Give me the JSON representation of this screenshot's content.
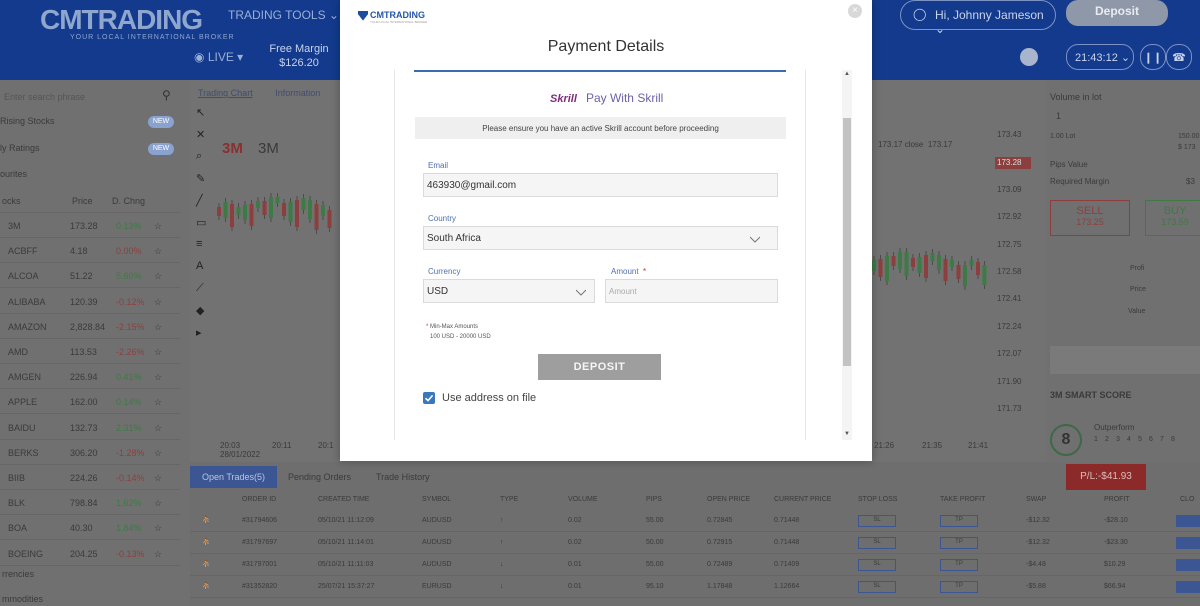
{
  "app": {
    "logo": "CMTRADING",
    "logo_sub": "YOUR LOCAL INTERNATIONAL BROKER",
    "nav_tools": "TRADING TOOLS",
    "user_greeting": "Hi, Johnny Jameson",
    "deposit_label": "Deposit",
    "live_label": "LIVE",
    "free_margin_label": "Free Margin",
    "free_margin_value": "$126.20",
    "clock": "21:43:12"
  },
  "left_panel": {
    "search_placeholder": "Enter search phrase",
    "items": [
      {
        "label": "Rising Stocks",
        "badge": "NEW"
      },
      {
        "label": "ly Ratings",
        "badge": "NEW"
      },
      {
        "label": "ourites",
        "badge": ""
      }
    ],
    "columns": [
      "ocks",
      "Price",
      "D. Chng"
    ],
    "stocks": [
      {
        "name": "3M",
        "price": "173.28",
        "change": "0.13%",
        "dir": "up"
      },
      {
        "name": "ACBFF",
        "price": "4.18",
        "change": "0.00%",
        "dir": "dn"
      },
      {
        "name": "ALCOA",
        "price": "51.22",
        "change": "5.60%",
        "dir": "up"
      },
      {
        "name": "ALIBABA",
        "price": "120.39",
        "change": "-0.12%",
        "dir": "dn"
      },
      {
        "name": "AMAZON",
        "price": "2,828.84",
        "change": "-2.15%",
        "dir": "dn"
      },
      {
        "name": "AMD",
        "price": "113.53",
        "change": "-2.26%",
        "dir": "dn"
      },
      {
        "name": "AMGEN",
        "price": "226.94",
        "change": "0.41%",
        "dir": "up"
      },
      {
        "name": "APPLE",
        "price": "162.00",
        "change": "0.14%",
        "dir": "up"
      },
      {
        "name": "BAIDU",
        "price": "132.73",
        "change": "2.31%",
        "dir": "up"
      },
      {
        "name": "BERKS",
        "price": "306.20",
        "change": "-1.28%",
        "dir": "dn"
      },
      {
        "name": "BIIB",
        "price": "224.26",
        "change": "-0.14%",
        "dir": "dn"
      },
      {
        "name": "BLK",
        "price": "798.84",
        "change": "1.62%",
        "dir": "up"
      },
      {
        "name": "BOA",
        "price": "40.30",
        "change": "1.84%",
        "dir": "up"
      },
      {
        "name": "BOEING",
        "price": "204.25",
        "change": "-0.13%",
        "dir": "dn"
      }
    ],
    "footer": [
      "rrencies",
      "mmodities"
    ]
  },
  "chart": {
    "tabs": [
      "Trading Chart",
      "Information"
    ],
    "symbol_logo": "3M",
    "symbol_name": "3M",
    "close_labels": [
      "173.17 close",
      "173.17"
    ],
    "prices": [
      "173.43",
      "173.28",
      "173.09",
      "172.92",
      "172.75",
      "172.58",
      "172.41",
      "172.24",
      "172.07",
      "171.90",
      "171.73"
    ],
    "price_tag": "173.28",
    "times": [
      "20:03",
      "20:11",
      "20:1",
      "21:26",
      "21:35",
      "21:41"
    ],
    "date": "28/01/2022"
  },
  "right_panel": {
    "volume_label": "Volume in lot",
    "volume_value": "1",
    "lot_left": "1.00 Lot",
    "lot_right": "150.00",
    "lot_sub": "$ 173",
    "pips_value": "Pips Value",
    "required_margin": "Required Margin",
    "required_margin_value": "$3",
    "sell_label": "SELL",
    "sell_price": "173.25",
    "buy_label": "BUY",
    "buy_price": "173.59",
    "profit_label": "Profi",
    "price_label": "Price",
    "value_label": "Value",
    "smart_score_label": "3M SMART SCORE",
    "smart_score": "8",
    "outperform": "Outperform",
    "score_ticks": [
      "1",
      "2",
      "3",
      "4",
      "5",
      "6",
      "7",
      "8"
    ]
  },
  "bottom": {
    "tabs": [
      "Open Trades(5)",
      "Pending Orders",
      "Trade History"
    ],
    "pl_badge": "P/L:-$41.93",
    "columns": [
      "ORDER ID",
      "CREATED TIME",
      "SYMBOL",
      "TYPE",
      "VOLUME",
      "PIPS",
      "OPEN PRICE",
      "CURRENT PRICE",
      "STOP LOSS",
      "TAKE PROFIT",
      "SWAP",
      "PROFIT",
      "CLO"
    ],
    "rows": [
      {
        "id": "#31794606",
        "time": "05/10/21 11:12:09",
        "symbol": "AUDUSD",
        "type": "↑",
        "volume": "0.02",
        "pips": "55.00",
        "open": "0.72845",
        "current": "0.71448",
        "swap": "-$12.32",
        "profit": "-$28.10"
      },
      {
        "id": "#31797697",
        "time": "05/10/21 11:14:01",
        "symbol": "AUDUSD",
        "type": "↑",
        "volume": "0.02",
        "pips": "50.00",
        "open": "0.72915",
        "current": "0.71448",
        "swap": "-$12.32",
        "profit": "-$23.30"
      },
      {
        "id": "#31797001",
        "time": "05/10/21 11:11:03",
        "symbol": "AUDUSD",
        "type": "↓",
        "volume": "0.01",
        "pips": "55.00",
        "open": "0.72489",
        "current": "0.71409",
        "swap": "-$4.48",
        "profit": "$10.29"
      },
      {
        "id": "#31352820",
        "time": "25/07/21 15:37:27",
        "symbol": "EURUSD",
        "type": "↓",
        "volume": "0.01",
        "pips": "95.10",
        "open": "1.17848",
        "current": "1.12664",
        "swap": "-$5.88",
        "profit": "$66.94"
      }
    ],
    "sl_label": "SL",
    "tp_label": "TP"
  },
  "modal": {
    "logo": "CMTRADING",
    "logo_sub": "YOUR LOCAL INTERNATIONAL BROKER",
    "title": "Payment Details",
    "skrill_logo": "Skrill",
    "skrill_text": "Pay With Skrill",
    "notice": "Please ensure you have an active Skrill account before proceeding",
    "email_label": "Email",
    "email_value": "463930@gmail.com",
    "country_label": "Country",
    "country_value": "South Africa",
    "currency_label": "Currency",
    "currency_value": "USD",
    "amount_label": "Amount",
    "amount_placeholder": "Amount",
    "required_mark": "*",
    "minmax_label": "Min-Max Amounts",
    "minmax_value": "100 USD - 20000 USD",
    "deposit_button": "DEPOSIT",
    "use_address": "Use address on file"
  },
  "colors": {
    "brand_blue": "#133a8c",
    "accent_blue": "#3a78be",
    "sell_red": "#8c3f3f",
    "buy_green": "#3d7a45"
  }
}
